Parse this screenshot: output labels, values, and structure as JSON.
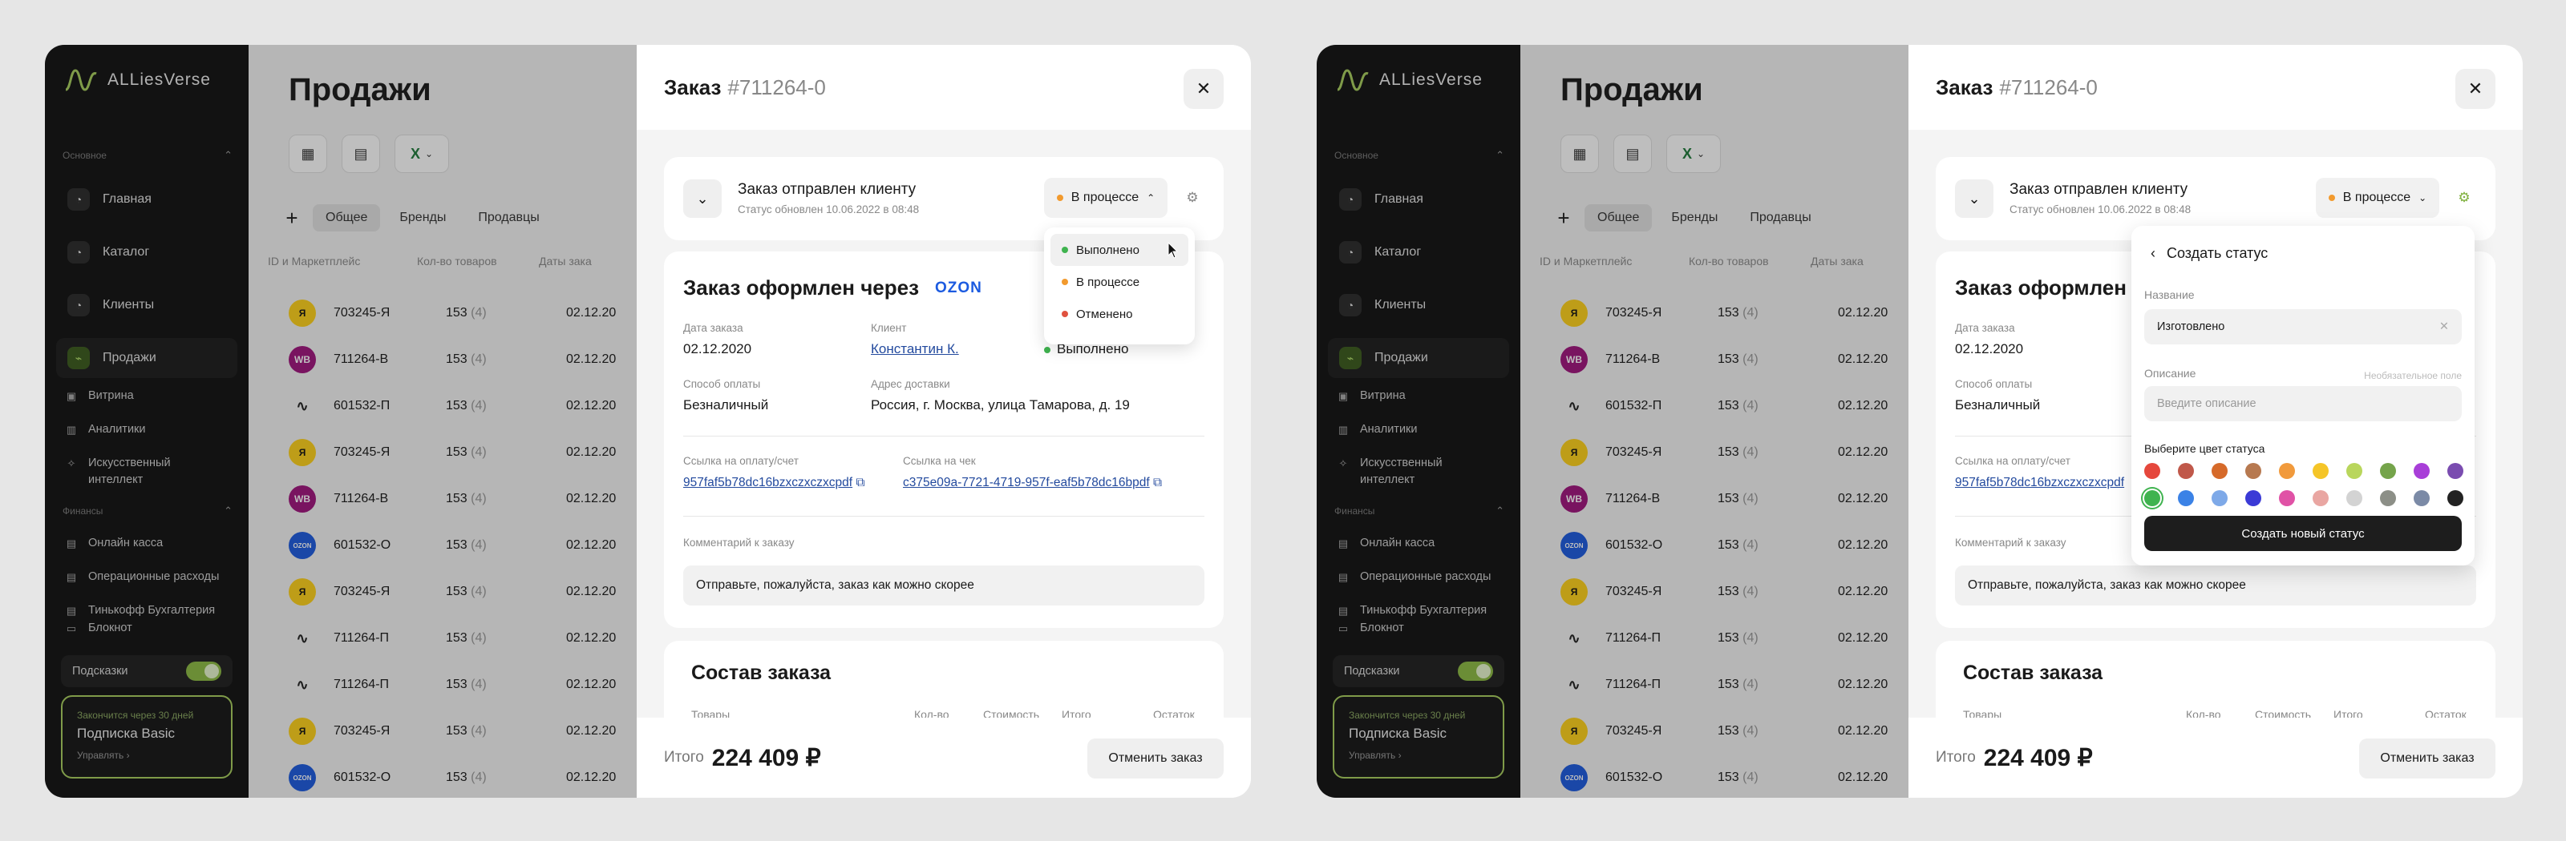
{
  "brand": {
    "name": "ALLiesVerse"
  },
  "sidebar": {
    "section_main": "Основное",
    "main_items": [
      {
        "label": "Главная",
        "icon": "dashboard-icon"
      },
      {
        "label": "Каталог",
        "icon": "catalog-icon"
      },
      {
        "label": "Клиенты",
        "icon": "clients-icon"
      },
      {
        "label": "Продажи",
        "icon": "sales-icon"
      }
    ],
    "sub_items": [
      "Витрина",
      "Аналитики",
      "Искусственный интеллект"
    ],
    "section_finance": "Финансы",
    "finance_items": [
      "Онлайн касса",
      "Операционные расходы",
      "Тинькофф Бухгалтерия"
    ],
    "notebook": "Блокнот",
    "hints": "Подсказки",
    "subscription": {
      "note": "Закончится через 30 дней",
      "title": "Подписка Basic",
      "manage": "Управлять"
    }
  },
  "page": {
    "title": "Продажи"
  },
  "tabs": [
    "Общее",
    "Бренды",
    "Продавцы"
  ],
  "table": {
    "headers": [
      "ID и Маркетплейс",
      "Кол-во товаров",
      "Даты зака"
    ],
    "rows": [
      {
        "logo": "Я",
        "id": "703245-Я",
        "qty": "153",
        "qty_extra": "(4)",
        "date": "02.12.20"
      },
      {
        "logo": "WB",
        "id": "711264-В",
        "qty": "153",
        "qty_extra": "(4)",
        "date": "02.12.20"
      },
      {
        "logo": "∿",
        "id": "601532-П",
        "qty": "153",
        "qty_extra": "(4)",
        "date": "02.12.20"
      },
      {
        "logo": "Я",
        "id": "703245-Я",
        "qty": "153",
        "qty_extra": "(4)",
        "date": "02.12.20"
      },
      {
        "logo": "WB",
        "id": "711264-В",
        "qty": "153",
        "qty_extra": "(4)",
        "date": "02.12.20"
      },
      {
        "logo": "OZON",
        "id": "601532-О",
        "qty": "153",
        "qty_extra": "(4)",
        "date": "02.12.20"
      },
      {
        "logo": "Я",
        "id": "703245-Я",
        "qty": "153",
        "qty_extra": "(4)",
        "date": "02.12.20"
      },
      {
        "logo": "∿",
        "id": "711264-П",
        "qty": "153",
        "qty_extra": "(4)",
        "date": "02.12.20"
      },
      {
        "logo": "∿",
        "id": "711264-П",
        "qty": "153",
        "qty_extra": "(4)",
        "date": "02.12.20"
      },
      {
        "logo": "Я",
        "id": "703245-Я",
        "qty": "153",
        "qty_extra": "(4)",
        "date": "02.12.20"
      },
      {
        "logo": "OZON",
        "id": "601532-О",
        "qty": "153",
        "qty_extra": "(4)",
        "date": "02.12.20"
      }
    ]
  },
  "modal": {
    "title": "Заказ",
    "order_id": "#711264-0",
    "status_title": "Заказ отправлен клиенту",
    "status_sub": "Статус обновлен 10.06.2022 в 08:48",
    "status_value": "В процессе",
    "order_via": "Заказ оформлен через",
    "ozon": "OZON",
    "date_label": "Дата заказа",
    "date_value": "02.12.2020",
    "client_label": "Клиент",
    "client_value": "Константин К.",
    "done_value": "Выполнено",
    "pay_label": "Способ оплаты",
    "pay_value": "Безналичный",
    "addr_label": "Адрес доставки",
    "addr_value": "Россия, г. Москва, улица Тамарова, д. 19",
    "invoice_label": "Ссылка на оплату/счет",
    "invoice_value": "957faf5b78dc16bzxczxczxcpdf",
    "check_label": "Ссылка на чек",
    "check_value": "c375e09a-7721-4719-957f-eaf5b78dc16bpdf",
    "comment_label": "Комментарий к заказу",
    "comment_value": "Отправьте, пожалуйста, заказ как можно скорее",
    "composition_title": "Состав заказа",
    "composition_headers": [
      "Товары",
      "Кол-во",
      "Стоимость",
      "Итого",
      "Остаток"
    ],
    "total_label": "Итого",
    "total_value": "224 409 ₽",
    "cancel": "Отменить заказ"
  },
  "status_menu": [
    {
      "label": "Выполнено",
      "color": "#3fb34f"
    },
    {
      "label": "В процессе",
      "color": "#f29a2e"
    },
    {
      "label": "Отменено",
      "color": "#e0523f"
    }
  ],
  "create_status": {
    "title": "Создать статус",
    "name_label": "Название",
    "name_value": "Изготовлено",
    "desc_label": "Описание",
    "desc_optional": "Необязательное поле",
    "desc_placeholder": "Введите описание",
    "color_label": "Выберите цвет статуса",
    "colors": [
      "#e5473c",
      "#c0584a",
      "#d66a2a",
      "#b77950",
      "#f19a3c",
      "#f5c528",
      "#b9d65c",
      "#75a44b",
      "#a83ed8",
      "#7a4cb0",
      "#3fb34f",
      "#3b82e6",
      "#7ea9e8",
      "#3b3ad6",
      "#e052a6",
      "#e9a6a2",
      "#d3d3d3",
      "#8c8f87",
      "#7b8aa6",
      "#222222"
    ],
    "button": "Создать новый статус"
  }
}
